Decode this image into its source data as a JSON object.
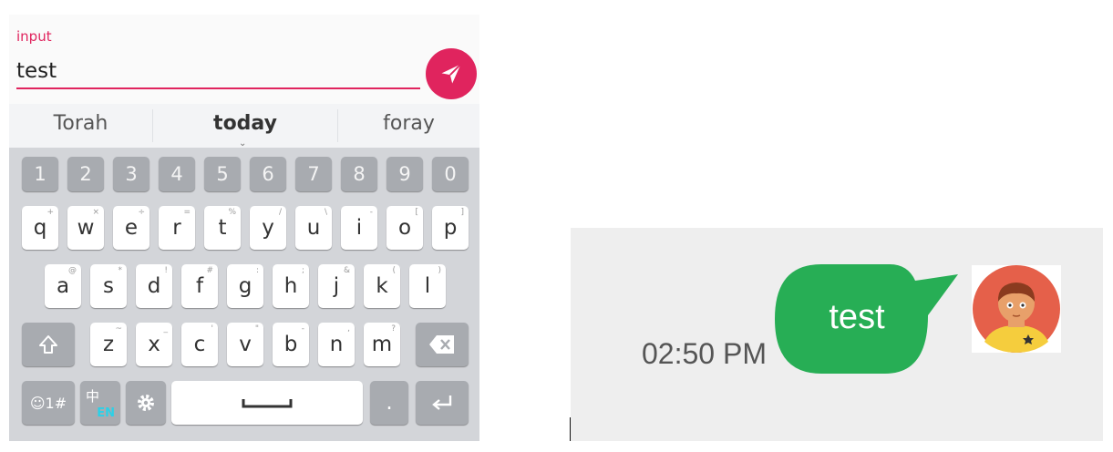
{
  "input": {
    "label": "input",
    "value": "test"
  },
  "send_icon": "send-icon",
  "suggestions": [
    "Torah",
    "today",
    "foray"
  ],
  "keyboard": {
    "numbers": [
      "1",
      "2",
      "3",
      "4",
      "5",
      "6",
      "7",
      "8",
      "9",
      "0"
    ],
    "row1": [
      {
        "key": "q",
        "sec": "+"
      },
      {
        "key": "w",
        "sec": "×"
      },
      {
        "key": "e",
        "sec": "÷"
      },
      {
        "key": "r",
        "sec": "="
      },
      {
        "key": "t",
        "sec": "%"
      },
      {
        "key": "y",
        "sec": "/"
      },
      {
        "key": "u",
        "sec": "\\"
      },
      {
        "key": "i",
        "sec": "-"
      },
      {
        "key": "o",
        "sec": "["
      },
      {
        "key": "p",
        "sec": "]"
      }
    ],
    "row2": [
      {
        "key": "a",
        "sec": "@"
      },
      {
        "key": "s",
        "sec": "*"
      },
      {
        "key": "d",
        "sec": "!"
      },
      {
        "key": "f",
        "sec": "#"
      },
      {
        "key": "g",
        "sec": ":"
      },
      {
        "key": "h",
        "sec": ";"
      },
      {
        "key": "j",
        "sec": "&"
      },
      {
        "key": "k",
        "sec": "("
      },
      {
        "key": "l",
        "sec": ")"
      }
    ],
    "row3": [
      {
        "key": "z",
        "sec": "~"
      },
      {
        "key": "x",
        "sec": "_"
      },
      {
        "key": "c",
        "sec": "'"
      },
      {
        "key": "v",
        "sec": "\""
      },
      {
        "key": "b",
        "sec": "-"
      },
      {
        "key": "n",
        "sec": ","
      },
      {
        "key": "m",
        "sec": "?"
      }
    ],
    "symbols_label": "☺1#",
    "lang_label_top": "中",
    "lang_label_bottom": "EN",
    "period_label": "."
  },
  "chat": {
    "timestamp": "02:50 PM",
    "message": "test",
    "bubble_color": "#27ae55",
    "avatar_icon": "user-avatar-icon"
  },
  "colors": {
    "accent": "#e0245e",
    "keyboard_bg": "#d3d5d9",
    "chat_bg": "#eeeeee"
  }
}
